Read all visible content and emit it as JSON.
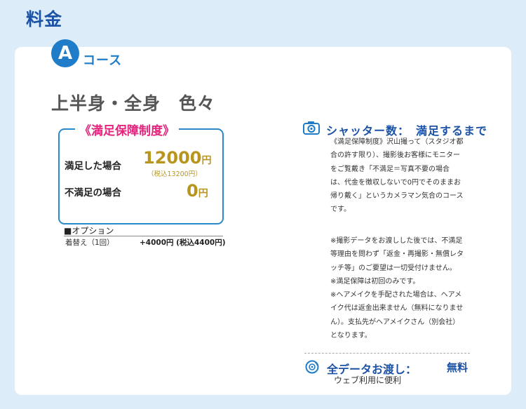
{
  "page": {
    "title": "料金"
  },
  "course": {
    "badge": "A",
    "word": "コース",
    "heading": "上半身・全身　色々"
  },
  "guarantee": {
    "title": "《満足保障制度》",
    "rows": [
      {
        "label": "満足した場合",
        "price": "12000",
        "yen": "円",
        "tax_note": "（税込13200円）"
      },
      {
        "label": "不満足の場合",
        "price": "0",
        "yen": "円"
      }
    ]
  },
  "options": {
    "title": "■オプション",
    "items": [
      {
        "name": "着替え（1回）",
        "price": "+4000円 (税込4400円)"
      }
    ]
  },
  "shutter": {
    "icon": "camera-icon",
    "label": "シャッター数：　満足するまで",
    "lines": [
      "《満足保障制度》沢山撮って（スタジオ都",
      "合の許す限り）、撮影後お客様にモニター",
      "をご覧戴き「不満足＝写真不要の場合",
      "は、代金を徴収しないで0円でそのままお",
      "帰り戴く」というカメラマン気合のコース",
      "です。"
    ],
    "notes": [
      "※撮影データをお渡しした後では、不満足",
      "等理由を問わず「返金・再撮影・無償レタ",
      "ッチ等」のご要望は一切受付けません。",
      "※満足保障は初回のみです。",
      "※ヘアメイクを手配された場合は、ヘアメ",
      "イク代は返金出来ません（無料になりませ",
      "ん）。支払先がヘアメイクさん（別会社）",
      "となります。"
    ]
  },
  "all_data": {
    "icon": "disc-icon",
    "label": "全データお渡し：",
    "value": "無料",
    "sub": "ウェブ利用に便利"
  }
}
